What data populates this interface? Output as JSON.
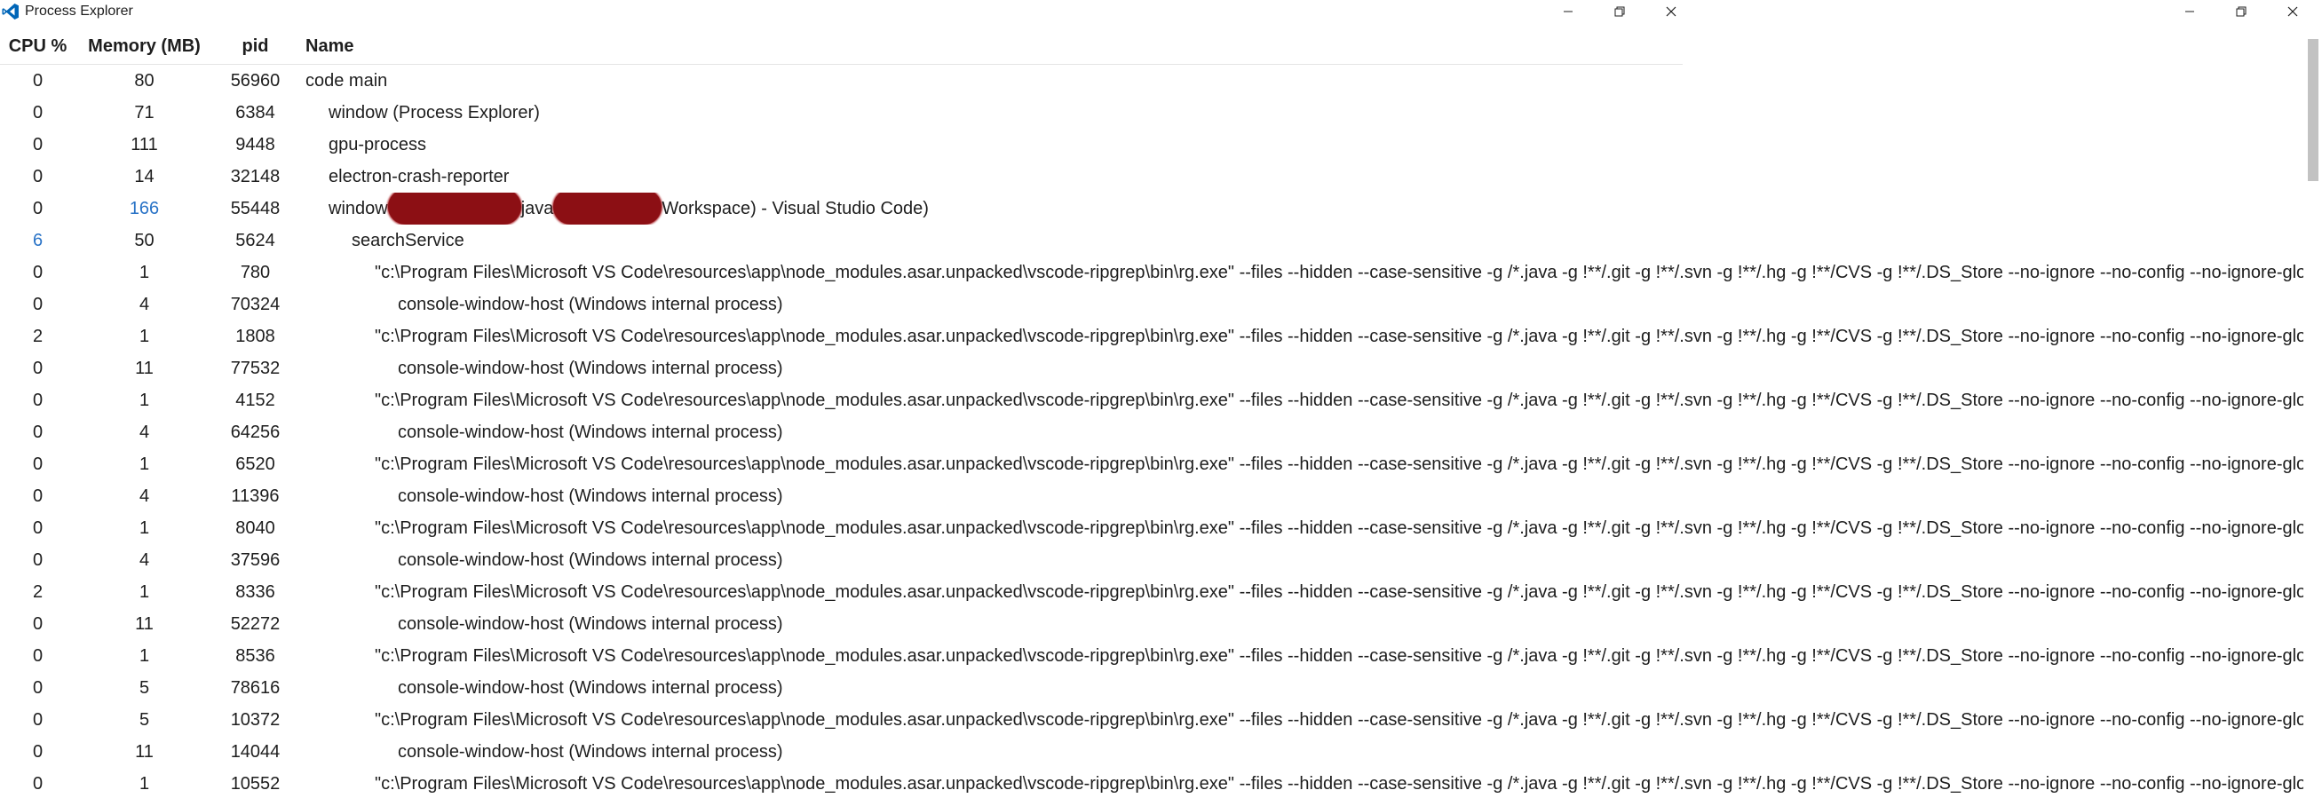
{
  "window": {
    "title": "Process Explorer",
    "logo_icon": "vscode-logo-icon",
    "accent_color": "#0066b8"
  },
  "table": {
    "headers": {
      "cpu": "CPU %",
      "memory": "Memory (MB)",
      "pid": "pid",
      "name": "Name"
    },
    "rows": [
      {
        "cpu": "0",
        "memory": "80",
        "pid": "56960",
        "indent": 0,
        "name": "code main"
      },
      {
        "cpu": "0",
        "memory": "71",
        "pid": "6384",
        "indent": 1,
        "name": "window (Process Explorer)"
      },
      {
        "cpu": "0",
        "memory": "111",
        "pid": "9448",
        "indent": 1,
        "name": "gpu-process"
      },
      {
        "cpu": "0",
        "memory": "14",
        "pid": "32148",
        "indent": 1,
        "name": "electron-crash-reporter"
      },
      {
        "cpu": "0",
        "memory": "166",
        "memory_highlight": true,
        "pid": "55448",
        "indent": 1,
        "redacted": true,
        "name_parts": [
          "window",
          "java",
          "Workspace) - Visual Studio Code)"
        ]
      },
      {
        "cpu": "6",
        "cpu_highlight": true,
        "memory": "50",
        "pid": "5624",
        "indent": 2,
        "name": "searchService"
      },
      {
        "cpu": "0",
        "memory": "1",
        "pid": "780",
        "indent": 3,
        "name": "\"c:\\Program Files\\Microsoft VS Code\\resources\\app\\node_modules.asar.unpacked\\vscode-ripgrep\\bin\\rg.exe\" --files --hidden --case-sensitive -g /*.java -g !**/.git -g !**/.svn -g !**/.hg -g !**/CVS -g !**/.DS_Store --no-ignore --no-config --no-ignore-global"
      },
      {
        "cpu": "0",
        "memory": "4",
        "pid": "70324",
        "indent": 4,
        "name": "console-window-host (Windows internal process)"
      },
      {
        "cpu": "2",
        "memory": "1",
        "pid": "1808",
        "indent": 3,
        "name": "\"c:\\Program Files\\Microsoft VS Code\\resources\\app\\node_modules.asar.unpacked\\vscode-ripgrep\\bin\\rg.exe\" --files --hidden --case-sensitive -g /*.java -g !**/.git -g !**/.svn -g !**/.hg -g !**/CVS -g !**/.DS_Store --no-ignore --no-config --no-ignore-global"
      },
      {
        "cpu": "0",
        "memory": "11",
        "pid": "77532",
        "indent": 4,
        "name": "console-window-host (Windows internal process)"
      },
      {
        "cpu": "0",
        "memory": "1",
        "pid": "4152",
        "indent": 3,
        "name": "\"c:\\Program Files\\Microsoft VS Code\\resources\\app\\node_modules.asar.unpacked\\vscode-ripgrep\\bin\\rg.exe\" --files --hidden --case-sensitive -g /*.java -g !**/.git -g !**/.svn -g !**/.hg -g !**/CVS -g !**/.DS_Store --no-ignore --no-config --no-ignore-global"
      },
      {
        "cpu": "0",
        "memory": "4",
        "pid": "64256",
        "indent": 4,
        "name": "console-window-host (Windows internal process)"
      },
      {
        "cpu": "0",
        "memory": "1",
        "pid": "6520",
        "indent": 3,
        "name": "\"c:\\Program Files\\Microsoft VS Code\\resources\\app\\node_modules.asar.unpacked\\vscode-ripgrep\\bin\\rg.exe\" --files --hidden --case-sensitive -g /*.java -g !**/.git -g !**/.svn -g !**/.hg -g !**/CVS -g !**/.DS_Store --no-ignore --no-config --no-ignore-global"
      },
      {
        "cpu": "0",
        "memory": "4",
        "pid": "11396",
        "indent": 4,
        "name": "console-window-host (Windows internal process)"
      },
      {
        "cpu": "0",
        "memory": "1",
        "pid": "8040",
        "indent": 3,
        "name": "\"c:\\Program Files\\Microsoft VS Code\\resources\\app\\node_modules.asar.unpacked\\vscode-ripgrep\\bin\\rg.exe\" --files --hidden --case-sensitive -g /*.java -g !**/.git -g !**/.svn -g !**/.hg -g !**/CVS -g !**/.DS_Store --no-ignore --no-config --no-ignore-global"
      },
      {
        "cpu": "0",
        "memory": "4",
        "pid": "37596",
        "indent": 4,
        "name": "console-window-host (Windows internal process)"
      },
      {
        "cpu": "2",
        "memory": "1",
        "pid": "8336",
        "indent": 3,
        "name": "\"c:\\Program Files\\Microsoft VS Code\\resources\\app\\node_modules.asar.unpacked\\vscode-ripgrep\\bin\\rg.exe\" --files --hidden --case-sensitive -g /*.java -g !**/.git -g !**/.svn -g !**/.hg -g !**/CVS -g !**/.DS_Store --no-ignore --no-config --no-ignore-global"
      },
      {
        "cpu": "0",
        "memory": "11",
        "pid": "52272",
        "indent": 4,
        "name": "console-window-host (Windows internal process)"
      },
      {
        "cpu": "0",
        "memory": "1",
        "pid": "8536",
        "indent": 3,
        "name": "\"c:\\Program Files\\Microsoft VS Code\\resources\\app\\node_modules.asar.unpacked\\vscode-ripgrep\\bin\\rg.exe\" --files --hidden --case-sensitive -g /*.java -g !**/.git -g !**/.svn -g !**/.hg -g !**/CVS -g !**/.DS_Store --no-ignore --no-config --no-ignore-global"
      },
      {
        "cpu": "0",
        "memory": "5",
        "pid": "78616",
        "indent": 4,
        "name": "console-window-host (Windows internal process)"
      },
      {
        "cpu": "0",
        "memory": "5",
        "pid": "10372",
        "indent": 3,
        "name": "\"c:\\Program Files\\Microsoft VS Code\\resources\\app\\node_modules.asar.unpacked\\vscode-ripgrep\\bin\\rg.exe\" --files --hidden --case-sensitive -g /*.java -g !**/.git -g !**/.svn -g !**/.hg -g !**/CVS -g !**/.DS_Store --no-ignore --no-config --no-ignore-global"
      },
      {
        "cpu": "0",
        "memory": "11",
        "pid": "14044",
        "indent": 4,
        "name": "console-window-host (Windows internal process)"
      },
      {
        "cpu": "0",
        "memory": "1",
        "pid": "10552",
        "indent": 3,
        "name": "\"c:\\Program Files\\Microsoft VS Code\\resources\\app\\node_modules.asar.unpacked\\vscode-ripgrep\\bin\\rg.exe\" --files --hidden --case-sensitive -g /*.java -g !**/.git -g !**/.svn -g !**/.hg -g !**/CVS -g !**/.DS_Store --no-ignore --no-config --no-ignore-global"
      }
    ]
  },
  "colors": {
    "highlight_value": "#2872c6",
    "redaction": "#8c0f14",
    "scroll_thumb": "#c2c2c2"
  }
}
